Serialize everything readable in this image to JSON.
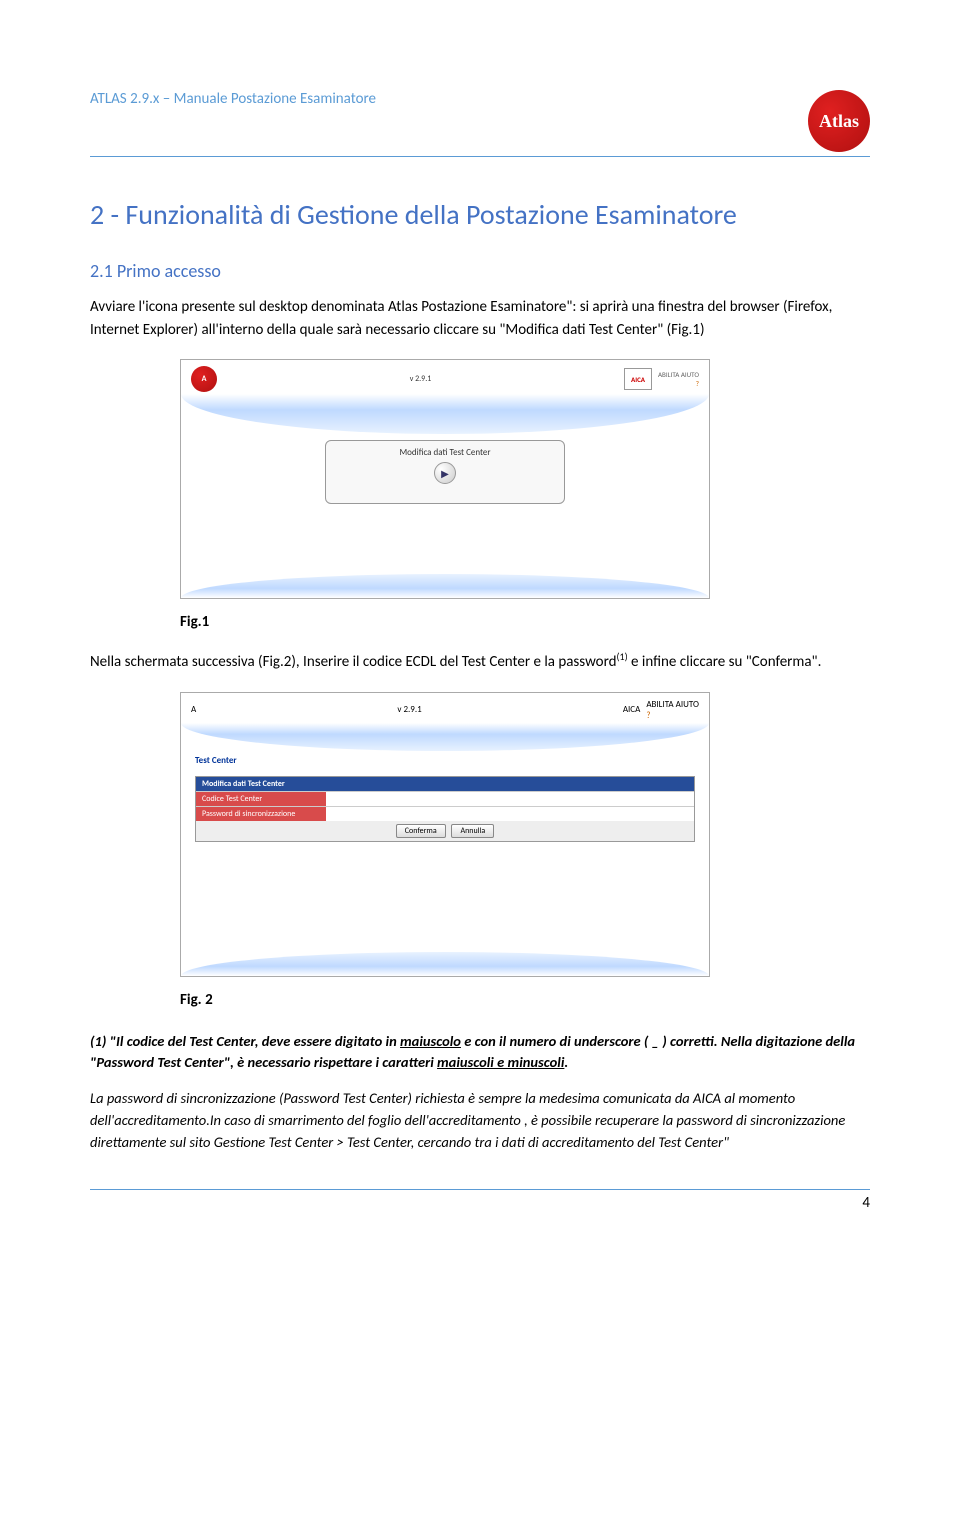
{
  "header": {
    "breadcrumb": "ATLAS 2.9.x – Manuale Postazione Esaminatore",
    "logo_text": "Atlas"
  },
  "section": {
    "title": "2 - Funzionalità di Gestione della Postazione Esaminatore",
    "subtitle": "2.1 Primo accesso",
    "para1": "Avviare l'icona presente sul desktop denominata Atlas Postazione Esaminatore\": si aprirà una finestra del browser (Firefox, Internet Explorer) all'interno della quale sarà necessario cliccare su \"Modifica dati Test Center\" (Fig.1)"
  },
  "fig1": {
    "version": "v 2.9.1",
    "aica": "AICA",
    "help": "ABILITA AIUTO",
    "card_title": "Modifica dati Test Center",
    "play_glyph": "▶",
    "caption": "Fig.1"
  },
  "para2_pre": "Nella schermata successiva (Fig.2), Inserire il codice ECDL del Test Center e la password",
  "para2_sup": "(1)",
  "para2_post": " e infine cliccare su \"Conferma\".",
  "fig2": {
    "version": "v 2.9.1",
    "aica": "AICA",
    "help": "ABILITA AIUTO",
    "crumb": "Test Center",
    "thead": "Modifica dati Test Center",
    "row1": "Codice Test Center",
    "row2": "Password di sincronizzazione",
    "btn_confirm": "Conferma",
    "btn_cancel": "Annulla",
    "caption": "Fig. 2"
  },
  "footnote1_a": "(1) \"Il codice del Test Center, deve essere digitato in ",
  "footnote1_u1": "maiuscolo",
  "footnote1_b": " e con il numero di underscore ( _ ) corretti. Nella digitazione della \"Password Test Center\", è necessario rispettare i caratteri ",
  "footnote1_u2": "maiuscoli e minuscoli",
  "footnote1_c": ".",
  "footnote2_a": "La password di sincronizzazione (Password Test Center)  richiesta è sempre la medesima comunicata da AICA al momento dell'accreditamento.In caso di smarrimento del foglio dell'accreditamento , è possibile recuperare la password di sincronizzazione direttamente sul sito ",
  "footnote2_u": "Gestione Test Center > Test Center",
  "footnote2_b": ",  cercando tra i dati di accreditamento del Test Center\"",
  "page_number": "4"
}
